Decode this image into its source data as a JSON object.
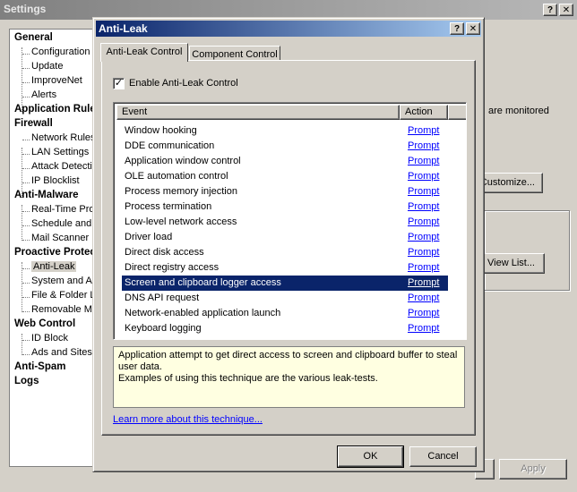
{
  "outer": {
    "title": "Settings",
    "help_glyph": "?",
    "close_glyph": "✕",
    "tree": [
      {
        "label": "General",
        "cat": true
      },
      {
        "label": "Configuration",
        "cat": false
      },
      {
        "label": "Update",
        "cat": false
      },
      {
        "label": "ImproveNet",
        "cat": false
      },
      {
        "label": "Alerts",
        "cat": false
      },
      {
        "label": "Application Rules",
        "cat": true
      },
      {
        "label": "Firewall",
        "cat": true
      },
      {
        "label": "Network Rules",
        "cat": false
      },
      {
        "label": "LAN Settings",
        "cat": false
      },
      {
        "label": "Attack Detection",
        "cat": false
      },
      {
        "label": "IP Blocklist",
        "cat": false
      },
      {
        "label": "Anti-Malware",
        "cat": true
      },
      {
        "label": "Real-Time Protection",
        "cat": false
      },
      {
        "label": "Schedule and Scans",
        "cat": false
      },
      {
        "label": "Mail Scanner",
        "cat": false
      },
      {
        "label": "Proactive Protection",
        "cat": true
      },
      {
        "label": "Anti-Leak",
        "cat": false,
        "selected": true
      },
      {
        "label": "System and Application",
        "cat": false
      },
      {
        "label": "File & Folder Lock",
        "cat": false
      },
      {
        "label": "Removable Media",
        "cat": false
      },
      {
        "label": "Web Control",
        "cat": true
      },
      {
        "label": "ID Block",
        "cat": false
      },
      {
        "label": "Ads and Sites",
        "cat": false
      },
      {
        "label": "Anti-Spam",
        "cat": true
      },
      {
        "label": "Logs",
        "cat": true
      }
    ],
    "monitored_text": "are monitored",
    "customize_label": "Customize...",
    "view_list_label": "View List...",
    "apply_label": "Apply"
  },
  "dialog": {
    "title": "Anti-Leak",
    "help_glyph": "?",
    "close_glyph": "✕",
    "tabs": [
      {
        "label": "Anti-Leak Control",
        "active": true
      },
      {
        "label": "Component Control",
        "active": false
      }
    ],
    "enable_label": "Enable Anti-Leak Control",
    "enable_checked": true,
    "check_glyph": "✓",
    "columns": {
      "event": "Event",
      "action": "Action"
    },
    "rows": [
      {
        "event": "Window hooking",
        "action": "Prompt"
      },
      {
        "event": "DDE communication",
        "action": "Prompt"
      },
      {
        "event": "Application window control",
        "action": "Prompt"
      },
      {
        "event": "OLE automation control",
        "action": "Prompt"
      },
      {
        "event": "Process memory injection",
        "action": "Prompt"
      },
      {
        "event": "Process termination",
        "action": "Prompt"
      },
      {
        "event": "Low-level network access",
        "action": "Prompt"
      },
      {
        "event": "Driver load",
        "action": "Prompt"
      },
      {
        "event": "Direct disk access",
        "action": "Prompt"
      },
      {
        "event": "Direct registry access",
        "action": "Prompt"
      },
      {
        "event": "Screen and clipboard logger access",
        "action": "Prompt",
        "selected": true
      },
      {
        "event": "DNS API request",
        "action": "Prompt"
      },
      {
        "event": "Network-enabled application launch",
        "action": "Prompt"
      },
      {
        "event": "Keyboard logging",
        "action": "Prompt"
      }
    ],
    "description_line1": "Application attempt to get direct access to screen and clipboard buffer to steal user data.",
    "description_line2": "Examples of using this technique are the various leak-tests.",
    "learn_more": "Learn more about this technique...",
    "ok_label": "OK",
    "cancel_label": "Cancel"
  }
}
